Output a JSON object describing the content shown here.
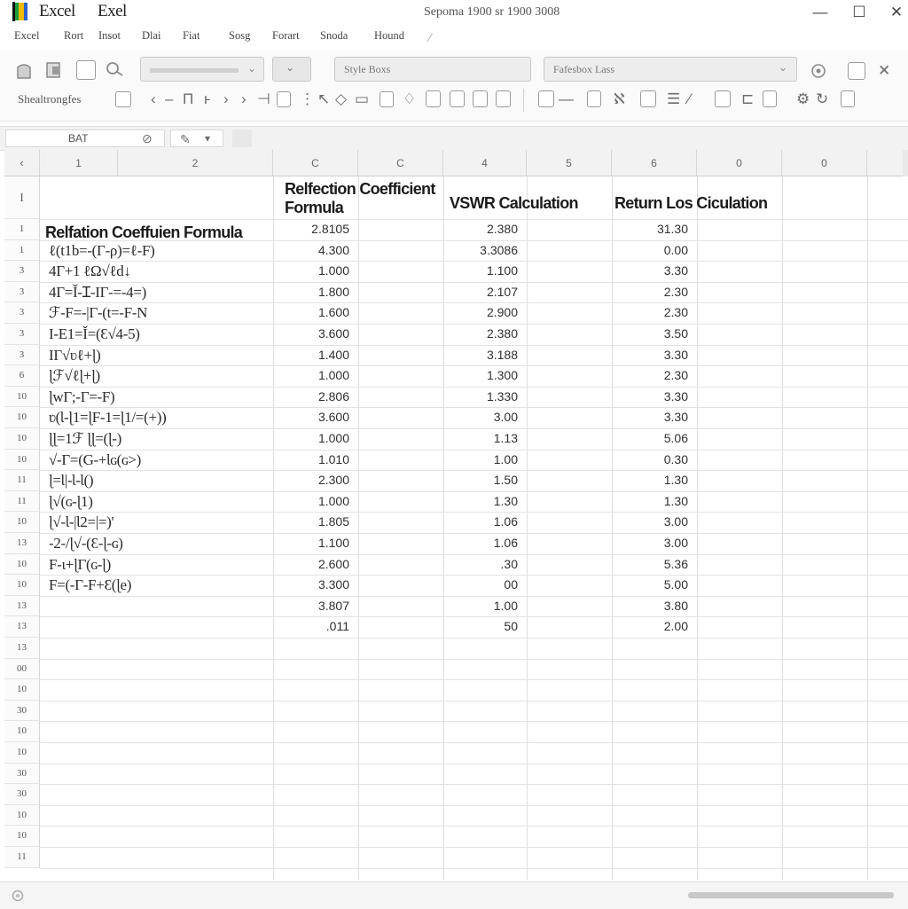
{
  "titlebar": {
    "app_name_1": "Excel",
    "app_name_2": "Exel",
    "window_title": "Sepoma 1900 sr 1900 3008",
    "controls": [
      "—",
      "☐",
      "✕"
    ]
  },
  "menu": {
    "items": [
      "Excel",
      "Rort",
      "Insot",
      "Dlai",
      "Fiat",
      "Sosg",
      "Forart",
      "Snoda",
      "Hound"
    ]
  },
  "ribbon": {
    "row1": {
      "font_box_text": "",
      "style_box_1": "Style Boxs",
      "style_box_2": "Fafesbox Lass"
    },
    "row2": {
      "label": "Shealtrongfes"
    }
  },
  "formula_bar": {
    "name_box": "BAT"
  },
  "sheet": {
    "column_headers": [
      "1",
      "2",
      "C",
      "C",
      "4",
      "5",
      "6",
      "0",
      "0",
      ""
    ],
    "header_row_label": "I",
    "headers": {
      "reflection": "Relfection Coefficient Formula",
      "vswr": "VSWR Calculation",
      "return_loss": "Return Los Ciculation"
    },
    "table_title": "Relfation Coeffuien Formula",
    "rows": [
      {
        "label": "1",
        "formula": "",
        "reflection": "2.8105",
        "vswr": "2.380",
        "rl": "31.30"
      },
      {
        "label": "1",
        "formula": "ℓ(t1b=-(Γ-ρ)=ℓ-F)",
        "reflection": "4.300",
        "vswr": "3.3086",
        "rl": "0.00"
      },
      {
        "label": "3",
        "formula": "4Γ+1 ℓΩ√ℓd↓",
        "reflection": "1.000",
        "vswr": "1.100",
        "rl": "3.30"
      },
      {
        "label": "3",
        "formula": "4Γ=Ǐ-Ɪ-ΙΓ-=-4=)",
        "reflection": "1.800",
        "vswr": "2.107",
        "rl": "2.30"
      },
      {
        "label": "3",
        "formula": "ℱ-F=-|Γ-(t=-F-N",
        "reflection": "1.600",
        "vswr": "2.900",
        "rl": "2.30"
      },
      {
        "label": "3",
        "formula": "Ι-Ε1=Ǐ=(Ɛ√4-5)",
        "reflection": "3.600",
        "vswr": "2.380",
        "rl": "3.50"
      },
      {
        "label": "3",
        "formula": "ΙΓ√ʋℓ+ɭ)",
        "reflection": "1.400",
        "vswr": "3.188",
        "rl": "3.30"
      },
      {
        "label": "6",
        "formula": "ɭℱ√ℓɭ+ɭ)",
        "reflection": "1.000",
        "vswr": "1.300",
        "rl": "2.30"
      },
      {
        "label": "10",
        "formula": "ɭwΓ;-Γ=-F)",
        "reflection": "2.806",
        "vswr": "1.330",
        "rl": "3.30"
      },
      {
        "label": "10",
        "formula": "ʋ(Ɩ-ɭ1=ɭF-1=ɭ1/=(+))",
        "reflection": "3.600",
        "vswr": "3.00",
        "rl": "3.30"
      },
      {
        "label": "10",
        "formula": "ɭɭ=1ℱ ɭɭ=(ɭ-)",
        "reflection": "1.000",
        "vswr": "1.13",
        "rl": "5.06"
      },
      {
        "label": "10",
        "formula": "√-Γ=(G-+Ɩɢ(ɢ>)",
        "reflection": "1.010",
        "vswr": "1.00",
        "rl": "0.30"
      },
      {
        "label": "11",
        "formula": "ɭ=Ɩ|-Ɩ-Ɩ()",
        "reflection": "2.300",
        "vswr": "1.50",
        "rl": "1.30"
      },
      {
        "label": "11",
        "formula": "ɭ√(ɢ-ɭ1)",
        "reflection": "1.000",
        "vswr": "1.30",
        "rl": "1.30"
      },
      {
        "label": "10",
        "formula": "ɭ√-Ɩ-|Ɩ2=|=)'",
        "reflection": "1.805",
        "vswr": "1.06",
        "rl": "3.00"
      },
      {
        "label": "13",
        "formula": "-2-/ɭ√-(Ɛ-ɭ-ɢ)",
        "reflection": "1.100",
        "vswr": "1.06",
        "rl": "3.00"
      },
      {
        "label": "10",
        "formula": "F-ɩ+ɭΓ(ɢ-ɭ)",
        "reflection": "2.600",
        "vswr": ".30",
        "rl": "5.36"
      },
      {
        "label": "10",
        "formula": "F=(-Γ-F+Ɛ(ɭe)",
        "reflection": "3.300",
        "vswr": "00",
        "rl": "5.00"
      },
      {
        "label": "13",
        "formula": "",
        "reflection": "3.807",
        "vswr": "1.00",
        "rl": "3.80"
      },
      {
        "label": "13",
        "formula": "",
        "reflection": ".011",
        "vswr": "50",
        "rl": "2.00"
      }
    ],
    "empty_row_labels": [
      "13",
      "00",
      "10",
      "30",
      "10",
      "10",
      "30",
      "30",
      "10",
      "10",
      "11"
    ]
  }
}
